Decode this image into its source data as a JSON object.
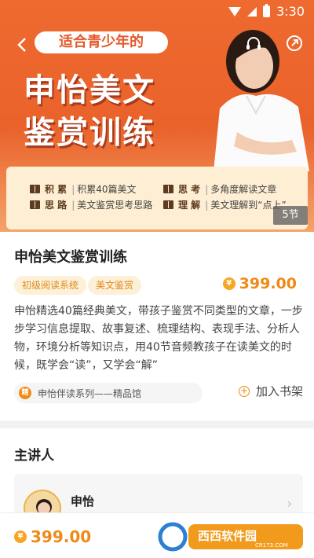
{
  "status_bar": {
    "time": "3:30"
  },
  "banner": {
    "tagline": "适合青少年的",
    "title_line1": "申怡美文",
    "title_line2": "鉴赏训练",
    "features": [
      {
        "key": "积 累",
        "value": "积累40篇美文"
      },
      {
        "key": "思 考",
        "value": "多角度解读文章"
      },
      {
        "key": "思 路",
        "value": "美文鉴赏思考思路"
      },
      {
        "key": "理 解",
        "value": "美文理解到“点上”"
      }
    ],
    "lesson_count": "5节"
  },
  "course": {
    "title": "申怡美文鉴赏训练",
    "tags": [
      "初级阅读系统",
      "美文鉴赏"
    ],
    "price": "399.00",
    "description": "申怡精选40篇经典美文，带孩子鉴赏不同类型的文章，一步步学习信息提取、故事复述、梳理结构、表现手法、分析人物，环境分析等知识点，用40节音频教孩子在读美文的时候，既学会“读”，又学会“解”",
    "series_badge": "精",
    "series": "申怡伴读系列——精品馆",
    "add_shelf_label": "加入书架"
  },
  "lecturer": {
    "section_title": "主讲人",
    "name": "申怡"
  },
  "bottom_bar": {
    "price": "399.00"
  },
  "watermark": {
    "brand": "西西软件园",
    "url": "CR173.COM"
  },
  "colors": {
    "banner": "#ee6a2f",
    "accent": "#f08a16",
    "tag_bg": "#fdf0d9"
  }
}
